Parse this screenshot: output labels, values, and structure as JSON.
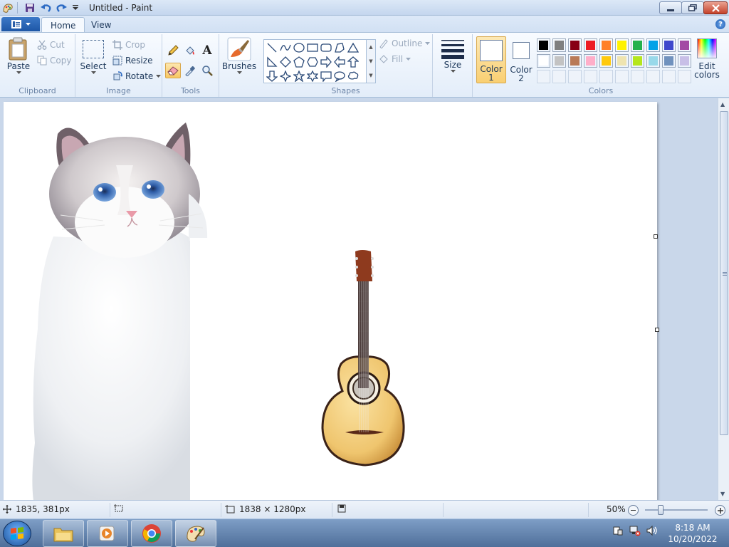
{
  "window": {
    "title": "Untitled - Paint"
  },
  "tabs": {
    "home": "Home",
    "view": "View"
  },
  "ribbon": {
    "clipboard": {
      "paste": "Paste",
      "cut": "Cut",
      "copy": "Copy",
      "label": "Clipboard"
    },
    "image": {
      "select": "Select",
      "crop": "Crop",
      "resize": "Resize",
      "rotate": "Rotate",
      "label": "Image"
    },
    "tools": {
      "label": "Tools",
      "text_glyph": "A"
    },
    "brushes": {
      "label": "Brushes"
    },
    "shapes": {
      "outline": "Outline",
      "fill": "Fill",
      "label": "Shapes"
    },
    "size": {
      "label": "Size"
    },
    "color1": {
      "label1": "Color",
      "label2": "1"
    },
    "color2": {
      "label1": "Color",
      "label2": "2"
    },
    "colors": {
      "label": "Colors",
      "edit1": "Edit",
      "edit2": "colors",
      "palette_row1": [
        "#000000",
        "#7f7f7f",
        "#880015",
        "#ed1c24",
        "#ff7f27",
        "#fff200",
        "#22b14c",
        "#00a2e8",
        "#3f48cc",
        "#a349a4"
      ],
      "palette_row2": [
        "#ffffff",
        "#c3c3c3",
        "#b97a57",
        "#ffaec9",
        "#ffc90e",
        "#efe4b0",
        "#b5e61d",
        "#99d9ea",
        "#7092be",
        "#c8bfe7"
      ]
    }
  },
  "status": {
    "cursor_pos": "1835, 381px",
    "image_size": "1838 × 1280px",
    "zoom": "50%"
  },
  "taskbar": {
    "time": "8:18 AM",
    "date": "10/20/2022",
    "apps": [
      "file-explorer",
      "media-player",
      "chrome",
      "paint"
    ]
  },
  "canvas": {
    "images": [
      "cat",
      "guitar"
    ]
  }
}
